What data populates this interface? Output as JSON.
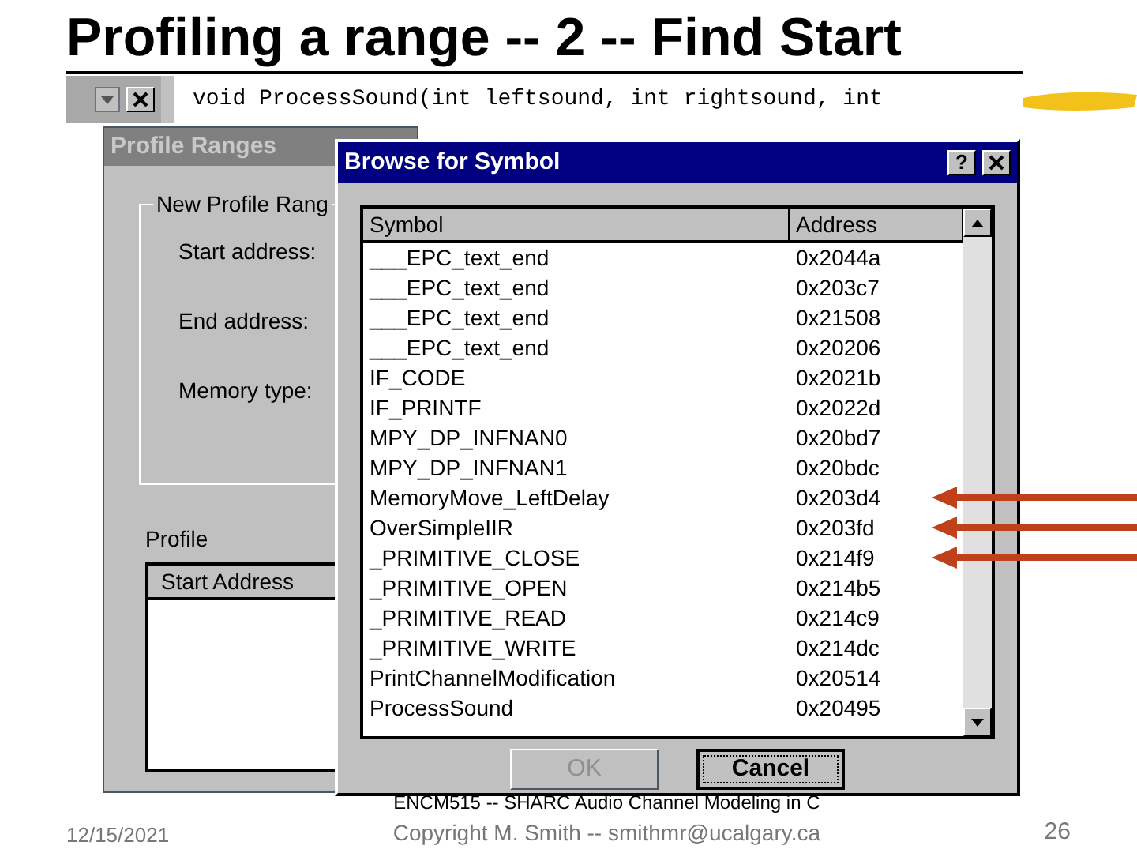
{
  "slide": {
    "title": "Profiling a range -- 2 -- Find Start",
    "footer": {
      "date": "12/15/2021",
      "course": "ENCM515 -- SHARC Audio Channel Modeling in C",
      "copyright": "Copyright M. Smith -- smithmr@ucalgary.ca",
      "page": "26"
    }
  },
  "editor": {
    "code": "void ProcessSound(int leftsound, int rightsound, int"
  },
  "profile_dialog": {
    "title": "Profile Ranges",
    "active": false,
    "group": "New Profile Rang",
    "fields": [
      "Start address:",
      "End address:",
      "Memory type:"
    ],
    "profile_label": "Profile",
    "columns": [
      "Start Address"
    ]
  },
  "symbol_dialog": {
    "title": "Browse for Symbol",
    "active": true,
    "help": "?",
    "columns": [
      "Symbol",
      "Address"
    ],
    "rows": [
      {
        "symbol": "___EPC_text_end",
        "address": "0x2044a",
        "marked": false
      },
      {
        "symbol": "___EPC_text_end",
        "address": "0x203c7",
        "marked": false
      },
      {
        "symbol": "___EPC_text_end",
        "address": "0x21508",
        "marked": false
      },
      {
        "symbol": "___EPC_text_end",
        "address": "0x20206",
        "marked": false
      },
      {
        "symbol": "IF_CODE",
        "address": "0x2021b",
        "marked": false
      },
      {
        "symbol": "IF_PRINTF",
        "address": "0x2022d",
        "marked": false
      },
      {
        "symbol": "MPY_DP_INFNAN0",
        "address": "0x20bd7",
        "marked": false
      },
      {
        "symbol": "MPY_DP_INFNAN1",
        "address": "0x20bdc",
        "marked": false
      },
      {
        "symbol": "MemoryMove_LeftDelay",
        "address": "0x203d4",
        "marked": true
      },
      {
        "symbol": "OverSimpleIIR",
        "address": "0x203fd",
        "marked": true
      },
      {
        "symbol": "_PRIMITIVE_CLOSE",
        "address": "0x214f9",
        "marked": true
      },
      {
        "symbol": "_PRIMITIVE_OPEN",
        "address": "0x214b5",
        "marked": false
      },
      {
        "symbol": "_PRIMITIVE_READ",
        "address": "0x214c9",
        "marked": false
      },
      {
        "symbol": "_PRIMITIVE_WRITE",
        "address": "0x214dc",
        "marked": false
      },
      {
        "symbol": "PrintChannelModification",
        "address": "0x20514",
        "marked": false
      },
      {
        "symbol": "ProcessSound",
        "address": "0x20495",
        "marked": false
      }
    ],
    "buttons": [
      {
        "label": "OK",
        "disabled": true
      },
      {
        "label": "Cancel",
        "disabled": false
      }
    ]
  }
}
